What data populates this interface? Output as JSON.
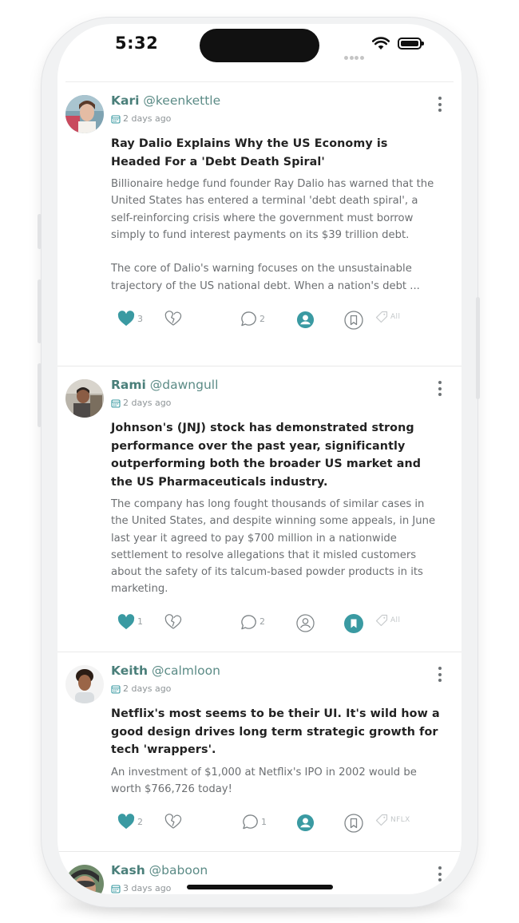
{
  "status_bar": {
    "time": "5:32"
  },
  "posts": [
    {
      "name": "Kari",
      "handle": "@keenkettle",
      "date": "2 days ago",
      "title": "Ray Dalio Explains Why the US Economy is Headed For a 'Debt Death Spiral'",
      "body": "Billionaire hedge fund founder Ray Dalio has warned that the United States has entered a terminal 'debt death spiral', a self-reinforcing crisis where the government must borrow simply to fund interest payments on its $39 trillion debt.\n\nThe core of Dalio's warning focuses on the unsustainable trajectory of the US national debt. When a nation's debt ...",
      "likes": "3",
      "comments": "2",
      "tag": "All",
      "profile_active": true,
      "bookmarked": false
    },
    {
      "name": "Rami",
      "handle": "@dawngull",
      "date": "2 days ago",
      "title": "Johnson's (JNJ) stock has demonstrated strong performance over the past year, significantly outperforming both the broader US market and the US Pharmaceuticals industry.",
      "body": "The company has long fought thousands of similar cases in the United States, and despite winning some appeals, in June last year it agreed to pay $700 million in a nationwide settlement to resolve allegations that it misled customers about the safety of its talcum-based powder products in its marketing.",
      "likes": "1",
      "comments": "2",
      "tag": "All",
      "profile_active": false,
      "bookmarked": true
    },
    {
      "name": "Keith",
      "handle": "@calmloon",
      "date": "2 days ago",
      "title": "Netflix's most seems to be their UI. It's wild how a good design drives long term strategic growth for tech 'wrappers'.",
      "body": "An investment of $1,000 at Netflix's IPO in 2002 would be worth $766,726 today!",
      "likes": "2",
      "comments": "1",
      "tag": "NFLX",
      "profile_active": true,
      "bookmarked": false
    },
    {
      "name": "Kash",
      "handle": "@baboon",
      "date": "3 days ago"
    }
  ],
  "colors": {
    "accent": "#3a9aa2",
    "name": "#4a7f7a",
    "muted_icon": "#9aa0a3"
  },
  "icons": [
    "calendar-icon",
    "heart-icon",
    "broken-heart-icon",
    "comment-icon",
    "profile-icon",
    "bookmark-icon",
    "tag-icon",
    "more-vertical-icon",
    "wifi-icon",
    "battery-icon"
  ]
}
